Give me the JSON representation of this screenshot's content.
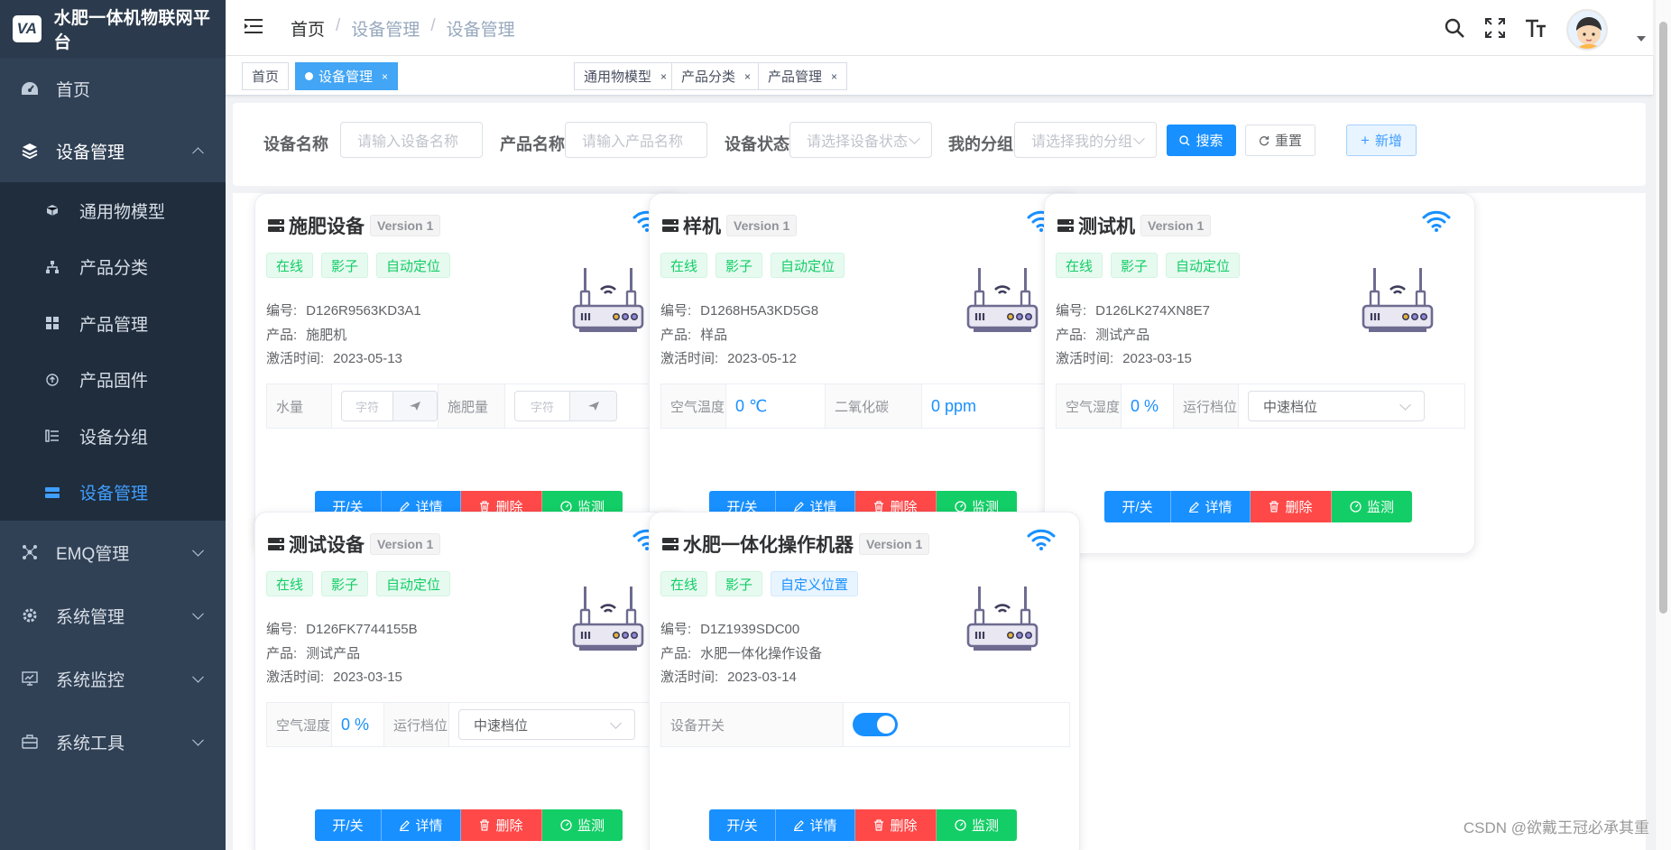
{
  "app": {
    "logo_mark": "VA",
    "title": "水肥一体机物联网平台"
  },
  "sidebar": {
    "top": [
      {
        "label": "首页",
        "icon": "dashboard-icon"
      },
      {
        "label": "设备管理",
        "icon": "device-stack-icon",
        "expanded": true
      }
    ],
    "sub": [
      {
        "label": "通用物模型",
        "icon": "cube-icon"
      },
      {
        "label": "产品分类",
        "icon": "tree-icon"
      },
      {
        "label": "产品管理",
        "icon": "grid-icon"
      },
      {
        "label": "产品固件",
        "icon": "firmware-icon"
      },
      {
        "label": "设备分组",
        "icon": "group-list-icon"
      },
      {
        "label": "设备管理",
        "icon": "device-list-icon",
        "active": true
      }
    ],
    "bottom": [
      {
        "label": "EMQ管理",
        "icon": "network-icon"
      },
      {
        "label": "系统管理",
        "icon": "settings-icon"
      },
      {
        "label": "系统监控",
        "icon": "monitor-icon"
      },
      {
        "label": "系统工具",
        "icon": "toolbox-icon"
      }
    ]
  },
  "header": {
    "breadcrumb": [
      "首页",
      "设备管理",
      "设备管理"
    ],
    "sep": "/"
  },
  "tabs": [
    {
      "label": "首页",
      "close": ""
    },
    {
      "label": "设备管理",
      "close": "×",
      "active": true
    },
    {
      "label": "通用物模型",
      "close": "×"
    },
    {
      "label": "产品分类",
      "close": "×"
    },
    {
      "label": "产品管理",
      "close": "×"
    }
  ],
  "search": {
    "device_name_label": "设备名称",
    "device_name_placeholder": "请输入设备名称",
    "product_name_label": "产品名称",
    "product_name_placeholder": "请输入产品名称",
    "status_label": "设备状态",
    "status_placeholder": "请选择设备状态",
    "group_label": "我的分组",
    "group_placeholder": "请选择我的分组",
    "search_btn": "搜索",
    "reset_btn": "重置",
    "add_btn": "新增"
  },
  "labels": {
    "code": "编号:",
    "product": "产品:",
    "activated": "激活时间:"
  },
  "actions": {
    "power": "开/关",
    "detail": "详情",
    "delete": "删除",
    "monitor": "监测"
  },
  "devices": [
    {
      "name": "施肥设备",
      "version": "Version 1",
      "tags": [
        "在线",
        "影子",
        "自动定位"
      ],
      "code": "D126R9563KD3A1",
      "product": "施肥机",
      "activated": "2023-05-13",
      "props": {
        "p1_label": "水量",
        "p1_placeholder": "字符",
        "p2_label": "施肥量",
        "p2_placeholder": "字符"
      }
    },
    {
      "name": "样机",
      "version": "Version 1",
      "tags": [
        "在线",
        "影子",
        "自动定位"
      ],
      "code": "D1268H5A3KD5G8",
      "product": "样品",
      "activated": "2023-05-12",
      "props": {
        "p1_label": "空气温度",
        "p1_value": "0 ℃",
        "p2_label": "二氧化碳",
        "p2_value": "0 ppm"
      }
    },
    {
      "name": "测试机",
      "version": "Version 1",
      "tags": [
        "在线",
        "影子",
        "自动定位"
      ],
      "code": "D126LK274XN8E7",
      "product": "测试产品",
      "activated": "2023-03-15",
      "props": {
        "p1_label": "空气湿度",
        "p1_value": "0 %",
        "p2_label": "运行档位",
        "p2_select": "中速档位"
      }
    },
    {
      "name": "测试设备",
      "version": "Version 1",
      "tags": [
        "在线",
        "影子",
        "自动定位"
      ],
      "code": "D126FK7744155B",
      "product": "测试产品",
      "activated": "2023-03-15",
      "props": {
        "p1_label": "空气湿度",
        "p1_value": "0 %",
        "p2_label": "运行档位",
        "p2_select": "中速档位"
      }
    },
    {
      "name": "水肥一体化操作机器",
      "version": "Version 1",
      "tags": [
        "在线",
        "影子",
        "自定义位置"
      ],
      "code": "D1Z1939SDC00",
      "product": "水肥一体化操作设备",
      "activated": "2023-03-14",
      "props": {
        "p1_label": "设备开关",
        "switch_on": true
      }
    }
  ],
  "watermark": "CSDN @欲戴王冠必承其重"
}
